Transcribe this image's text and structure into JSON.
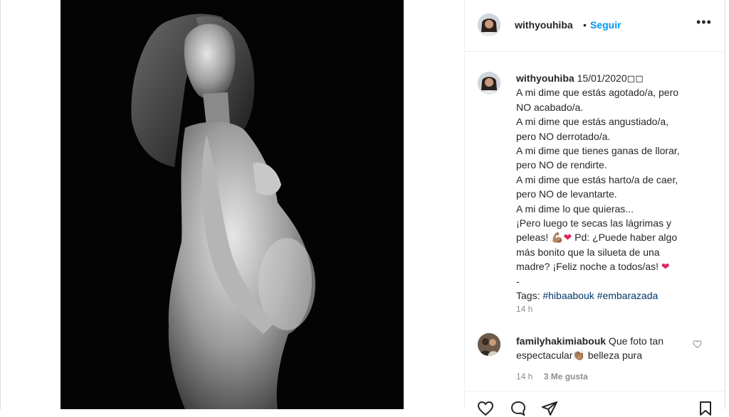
{
  "post": {
    "username": "withyouhiba",
    "separator": "•",
    "follow_label": "Seguir",
    "more_icon": "more-options-icon"
  },
  "caption": {
    "username": "withyouhiba",
    "date": "15/01/2020",
    "lines": [
      "A mi dime que estás agotado/a, pero",
      "NO acabado/a.",
      "A mi dime que estás angustiado/a,",
      "pero NO derrotado/a.",
      "A mi dime que tienes ganas de llorar,",
      "pero NO de rendirte.",
      "A mi dime que estás harto/a de caer,",
      "pero NO de levantarte.",
      "A mi dime lo que quieras...",
      "¡Pero luego te secas las lágrimas y"
    ],
    "line11_pre": "peleas! ",
    "line11_emoji": "💪🏽",
    "line11_heart": "❤",
    "line11_post": " Pd: ¿Puede haber algo",
    "line12": "más bonito que la silueta de una",
    "line13_pre": "madre? ¡Feliz noche a todos/as! ",
    "line13_heart": "❤",
    "line14": "-",
    "tags_label": "Tags: ",
    "tag1": "#hibaabouk",
    "tag2": "#embarazada",
    "time": "14 h"
  },
  "comment": {
    "username": "familyhakimiabouk",
    "text_pre": " Que foto tan",
    "text_line2": "espectacular",
    "emoji": "👏🏽",
    "text_post": " belleza pura",
    "time": "14 h",
    "likes": "3 Me gusta"
  },
  "colors": {
    "accent": "#0095f6",
    "heart": "#e0245e",
    "muted": "#8e8e8e",
    "tag": "#00376b"
  }
}
